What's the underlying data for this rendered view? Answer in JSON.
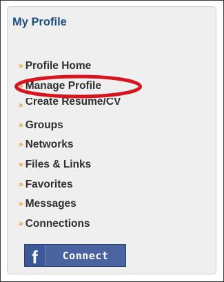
{
  "profile": {
    "title": "My Profile",
    "bullet": "»",
    "items": [
      {
        "label": "Profile Home"
      },
      {
        "label": "Manage Profile"
      },
      {
        "label": "Create Resume/CV"
      },
      {
        "label": "Groups"
      },
      {
        "label": "Networks"
      },
      {
        "label": "Files & Links"
      },
      {
        "label": "Favorites"
      },
      {
        "label": "Messages"
      },
      {
        "label": "Connections"
      }
    ],
    "highlight_color": "#d9141e"
  },
  "facebook_connect": {
    "icon": "facebook-f-icon",
    "icon_glyph": "f",
    "label": "Connect",
    "color": "#3b5998"
  }
}
